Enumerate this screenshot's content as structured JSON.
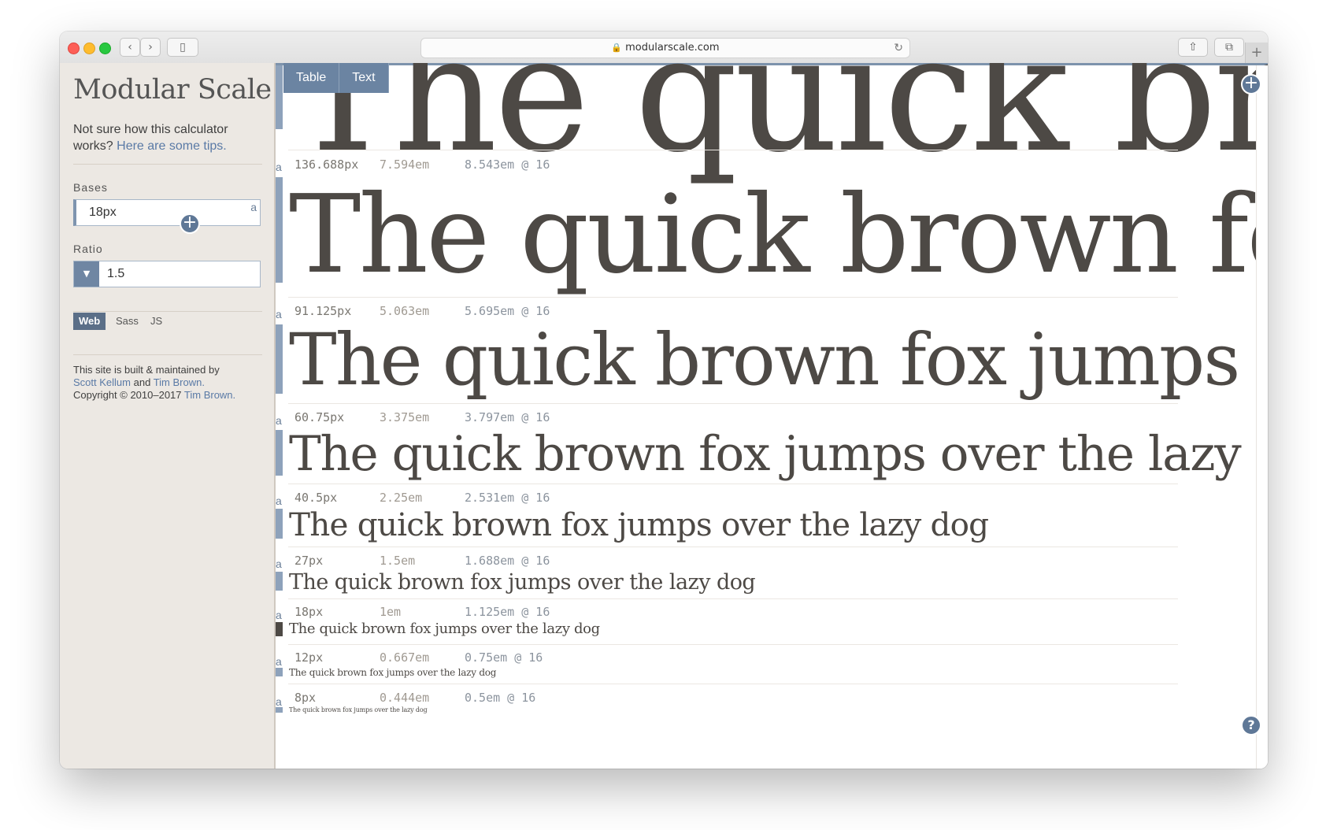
{
  "browser": {
    "url": "modularscale.com",
    "back_icon": "‹",
    "forward_icon": "›",
    "sidebar_icon": "▯",
    "reload_icon": "↻",
    "share_icon": "⇧",
    "tabs_icon": "⧉",
    "new_tab_icon": "+"
  },
  "sidebar": {
    "title": "Modular Scale",
    "tips_text": "Not sure how this calculator works?",
    "tips_link": "Here are some tips.",
    "bases_label": "Bases",
    "bases_value": "18px",
    "bases_badge": "a",
    "ratio_label": "Ratio",
    "ratio_value": "1.5",
    "output_tabs": [
      "Web",
      "Sass",
      "JS"
    ],
    "credits_prefix": "This site is built & maintained by",
    "credit_name_1": "Scott Kellum",
    "credit_and": "and",
    "credit_name_2": "Tim Brown.",
    "copyright_prefix": "Copyright © 2010–2017",
    "copyright_name": "Tim Brown."
  },
  "view_tabs": [
    "Table",
    "Text"
  ],
  "sample_text": "The quick brown fox jumps over the lazy dog",
  "scale": [
    {
      "px": "",
      "em": "",
      "rem": "",
      "size": 205
    },
    {
      "px": "136.688px",
      "em": "7.594em",
      "rem": "8.543em @ 16",
      "size": 137
    },
    {
      "px": "91.125px",
      "em": "5.063em",
      "rem": "5.695em @ 16",
      "size": 91
    },
    {
      "px": "60.75px",
      "em": "3.375em",
      "rem": "3.797em @ 16",
      "size": 61
    },
    {
      "px": "40.5px",
      "em": "2.25em",
      "rem": "2.531em @ 16",
      "size": 40.5
    },
    {
      "px": "27px",
      "em": "1.5em",
      "rem": "1.688em @ 16",
      "size": 27
    },
    {
      "px": "18px",
      "em": "1em",
      "rem": "1.125em @ 16",
      "size": 18
    },
    {
      "px": "12px",
      "em": "0.667em",
      "rem": "0.75em @ 16",
      "size": 12
    },
    {
      "px": "8px",
      "em": "0.444em",
      "rem": "0.5em @ 16",
      "size": 8
    }
  ],
  "row_badge": "a",
  "add_icon": "+",
  "help_icon": "?",
  "colors": {
    "accent": "#6b84a2",
    "sidebar_bg": "#ece8e3",
    "sample_text": "#4d4945"
  }
}
